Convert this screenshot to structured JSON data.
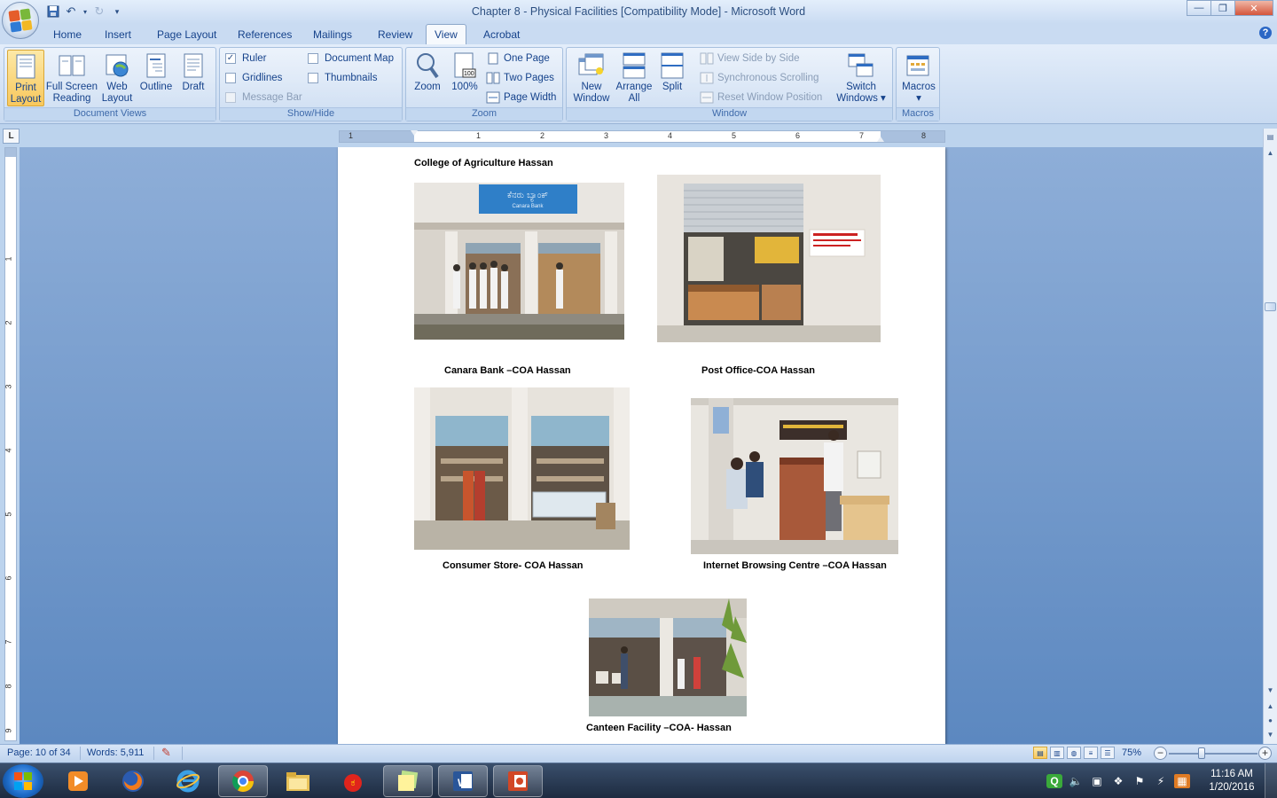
{
  "window": {
    "title": "Chapter  8 - Physical Facilities [Compatibility Mode] - Microsoft Word",
    "minimize": "—",
    "maximize": "❐",
    "close": "✕"
  },
  "tabs": [
    "Home",
    "Insert",
    "Page Layout",
    "References",
    "Mailings",
    "Review",
    "View",
    "Acrobat"
  ],
  "ribbon": {
    "document_views": {
      "label": "Document Views",
      "print_layout": "Print\nLayout",
      "full_screen_reading": "Full Screen\nReading",
      "web_layout": "Web\nLayout",
      "outline": "Outline",
      "draft": "Draft"
    },
    "show_hide": {
      "label": "Show/Hide",
      "ruler": "Ruler",
      "gridlines": "Gridlines",
      "message_bar": "Message Bar",
      "document_map": "Document Map",
      "thumbnails": "Thumbnails",
      "ruler_checked": "✓"
    },
    "zoom": {
      "label": "Zoom",
      "zoom": "Zoom",
      "hundred": "100%",
      "one_page": "One Page",
      "two_pages": "Two Pages",
      "page_width": "Page Width"
    },
    "window_group": {
      "label": "Window",
      "new_window": "New\nWindow",
      "arrange_all": "Arrange\nAll",
      "split": "Split",
      "view_side_by_side": "View Side by Side",
      "synchronous_scrolling": "Synchronous Scrolling",
      "reset_window_position": "Reset Window Position",
      "switch_windows": "Switch\nWindows ▾"
    },
    "macros": {
      "label": "Macros",
      "macros": "Macros\n▾"
    }
  },
  "ruler": {
    "corner": "L",
    "h_numbers": [
      "1",
      "1",
      "2",
      "3",
      "4",
      "5",
      "6",
      "7",
      "8"
    ],
    "v_numbers": [
      "1",
      "2",
      "3",
      "4",
      "5",
      "6",
      "7",
      "8",
      "9"
    ]
  },
  "document": {
    "heading": "College of  Agriculture  Hassan",
    "captions": {
      "canara_bank": "Canara  Bank –COA Hassan",
      "post_office": "Post  Office-COA Hassan",
      "consumer_store": "Consumer Store- COA Hassan",
      "internet_centre": "Internet Browsing Centre –COA  Hassan",
      "canteen": "Canteen Facility –COA- Hassan"
    },
    "sign_text": "ಕೆನರು ಬ್ಯಾಂಕ್  Canara Bank"
  },
  "status": {
    "page": "Page: 10 of 34",
    "words": "Words: 5,911",
    "zoom": "75%",
    "zoom_minus": "−",
    "zoom_plus": "+"
  },
  "taskbar": {
    "clock_time": "11:16 AM",
    "clock_date": "1/20/2016"
  },
  "colors": {
    "ribbon_blue": "#15428b",
    "doc_background": "#6f97cb",
    "selected_button": "#f8c85d",
    "taskbar": "#1d2b40"
  }
}
